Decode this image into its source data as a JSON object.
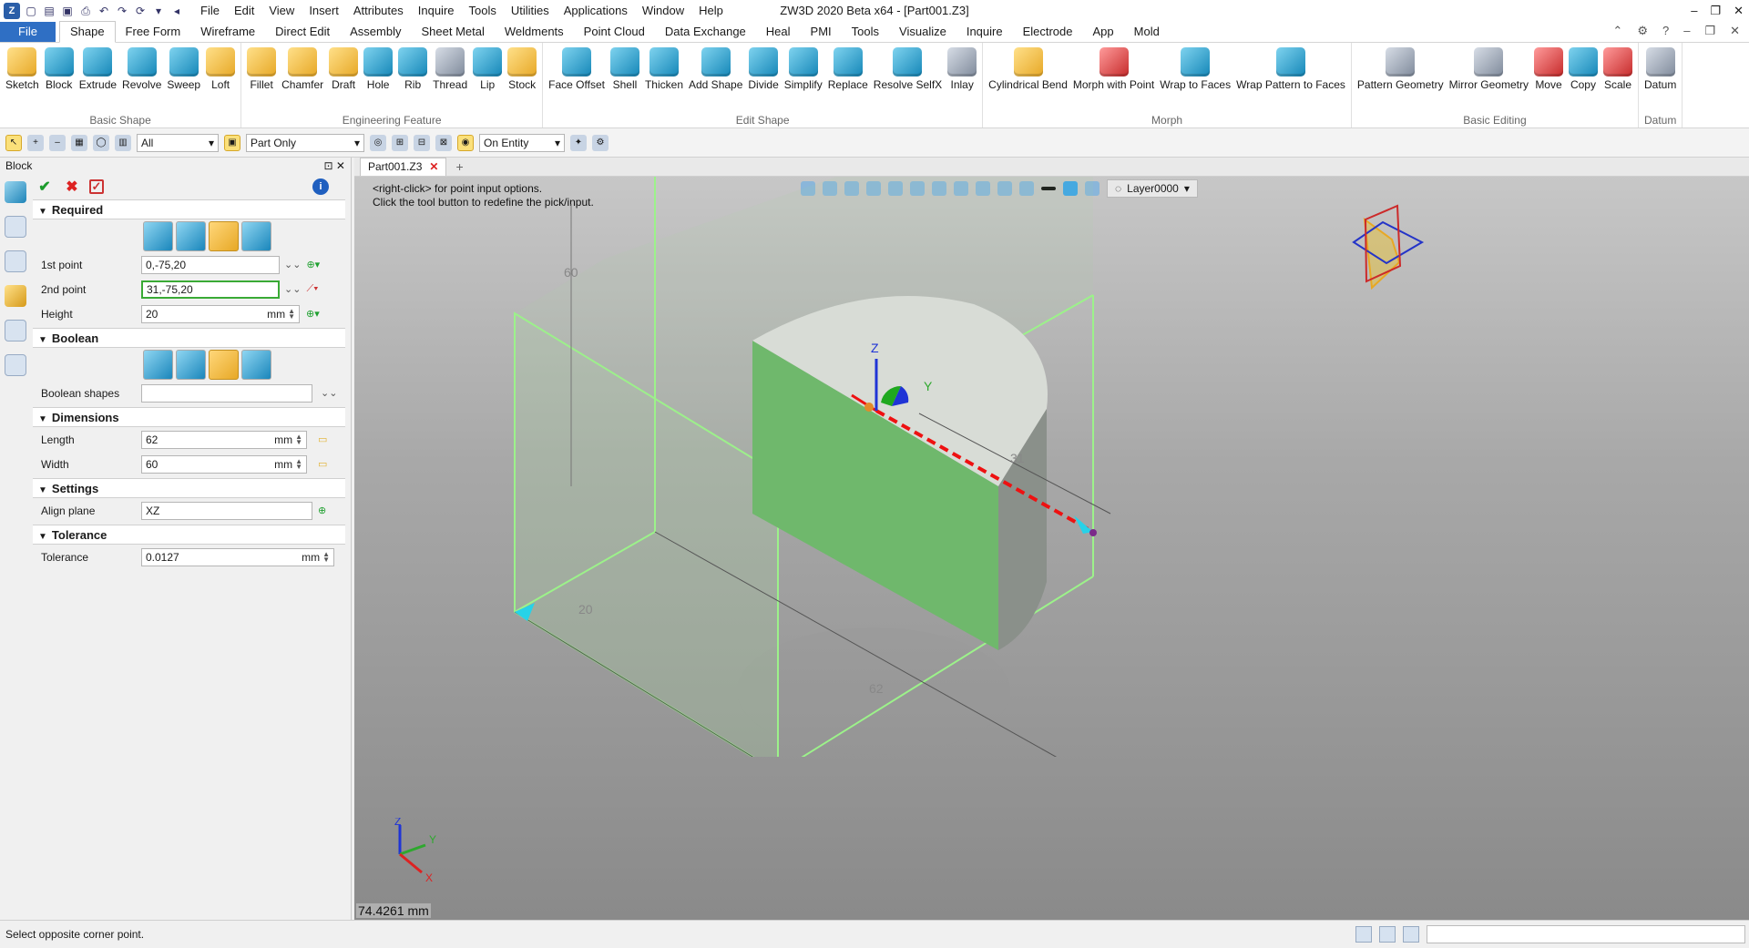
{
  "window": {
    "title": "ZW3D 2020 Beta x64 - [Part001.Z3]",
    "menu": [
      "File",
      "Edit",
      "View",
      "Insert",
      "Attributes",
      "Inquire",
      "Tools",
      "Utilities",
      "Applications",
      "Window",
      "Help"
    ]
  },
  "ribbon_tabs": [
    "File",
    "Shape",
    "Free Form",
    "Wireframe",
    "Direct Edit",
    "Assembly",
    "Sheet Metal",
    "Weldments",
    "Point Cloud",
    "Data Exchange",
    "Heal",
    "PMI",
    "Tools",
    "Visualize",
    "Inquire",
    "Electrode",
    "App",
    "Mold"
  ],
  "active_tab": "Shape",
  "ribbon": {
    "basic_shape": {
      "label": "Basic Shape",
      "buttons": [
        "Sketch",
        "Block",
        "Extrude",
        "Revolve",
        "Sweep",
        "Loft"
      ]
    },
    "engineering_feature": {
      "label": "Engineering Feature",
      "buttons": [
        "Fillet",
        "Chamfer",
        "Draft",
        "Hole",
        "Rib",
        "Thread",
        "Lip",
        "Stock"
      ]
    },
    "edit_shape": {
      "label": "Edit Shape",
      "buttons": [
        "Face Offset",
        "Shell",
        "Thicken",
        "Add Shape",
        "Divide",
        "Simplify",
        "Replace",
        "Resolve SelfX",
        "Inlay"
      ]
    },
    "morph": {
      "label": "Morph",
      "buttons": [
        "Cylindrical Bend",
        "Morph with Point",
        "Wrap to Faces",
        "Wrap Pattern to Faces"
      ]
    },
    "basic_editing": {
      "label": "Basic Editing",
      "buttons": [
        "Pattern Geometry",
        "Mirror Geometry",
        "Move",
        "Copy",
        "Scale"
      ]
    },
    "datum": {
      "label": "Datum",
      "buttons": [
        "Datum"
      ]
    }
  },
  "toolbar2": {
    "filter": "All",
    "scope": "Part Only",
    "pick": "On Entity"
  },
  "panel": {
    "title": "Block",
    "required": {
      "label": "Required",
      "first_point_label": "1st point",
      "first_point": "0,-75,20",
      "second_point_label": "2nd point",
      "second_point": "31,-75,20",
      "height_label": "Height",
      "height": "20",
      "height_unit": "mm"
    },
    "boolean": {
      "label": "Boolean",
      "shapes_label": "Boolean shapes",
      "shapes_value": ""
    },
    "dimensions": {
      "label": "Dimensions",
      "length_label": "Length",
      "length": "62",
      "width_label": "Width",
      "width": "60",
      "unit": "mm"
    },
    "settings": {
      "label": "Settings",
      "align_label": "Align plane",
      "align": "XZ"
    },
    "tolerance": {
      "label": "Tolerance",
      "tol_label": "Tolerance",
      "tol": "0.0127",
      "unit": "mm"
    }
  },
  "viewport": {
    "doc_tab": "Part001.Z3",
    "hint1": "<right-click> for point input options.",
    "hint2": "Click the tool button to redefine the pick/input.",
    "layer": "Layer0000",
    "dims": {
      "d60": "60",
      "d31": "31",
      "d20": "20",
      "d62": "62"
    },
    "axis": {
      "x": "X",
      "y": "Y",
      "z": "Z"
    },
    "readout": "74.4261 mm"
  },
  "status": {
    "message": "Select opposite corner point."
  }
}
